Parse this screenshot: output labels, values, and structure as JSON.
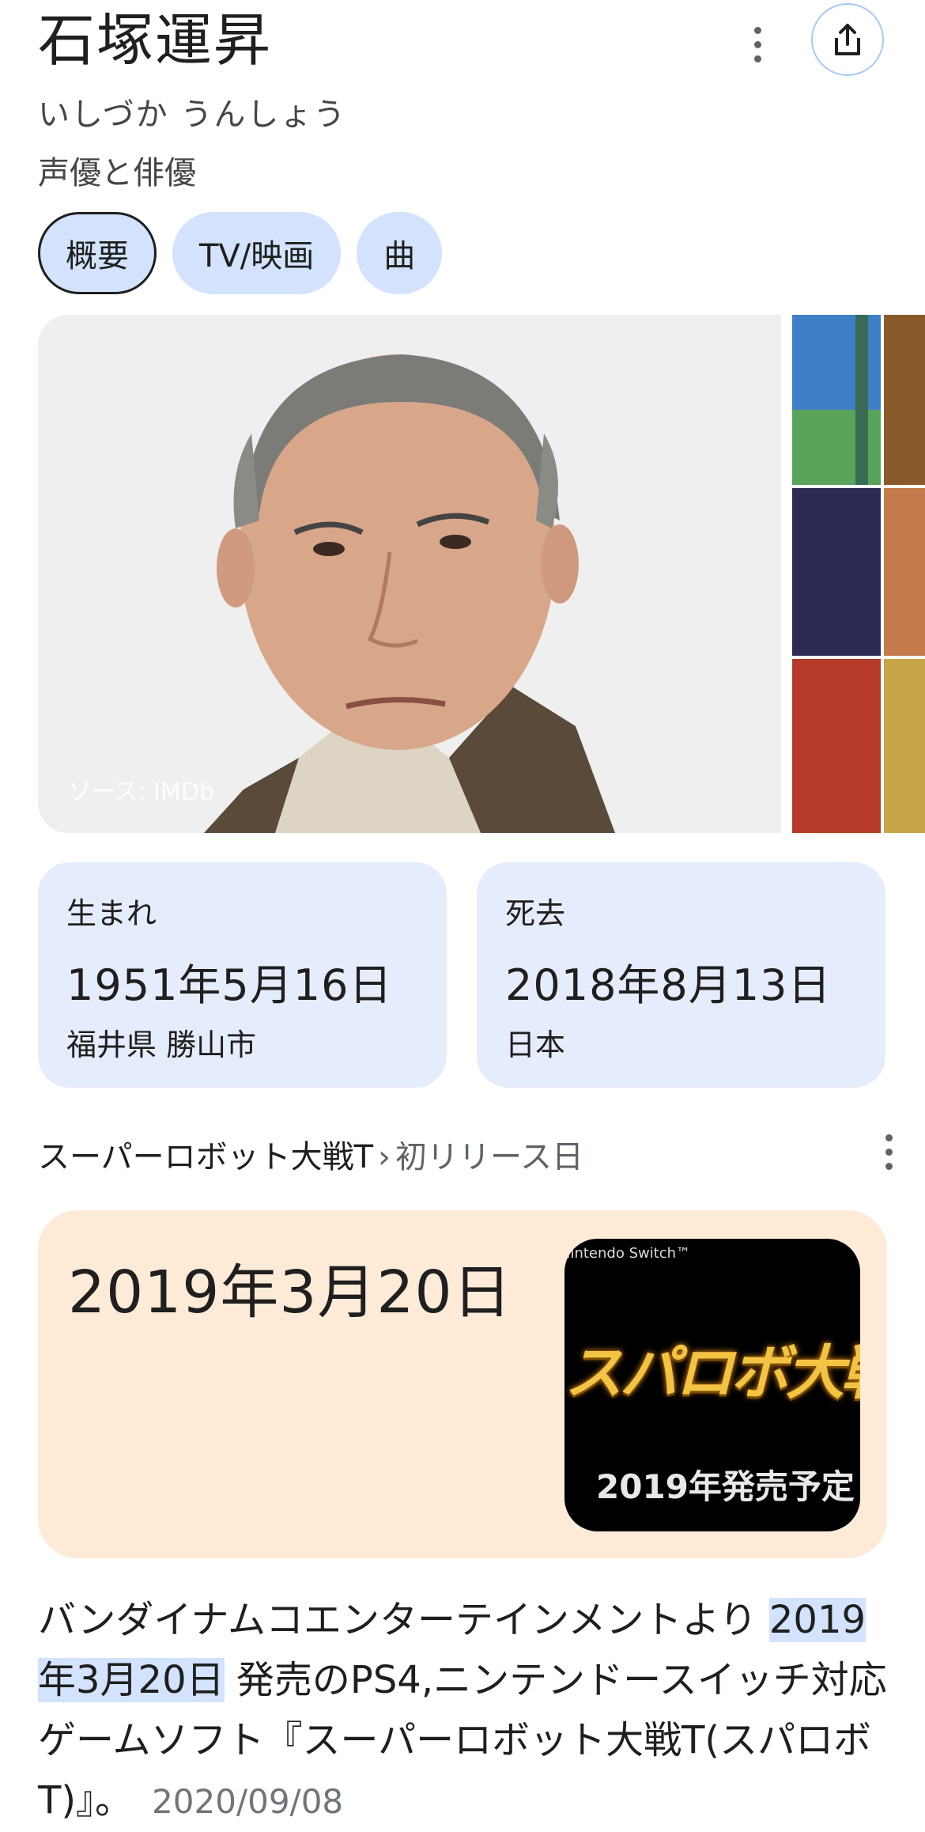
{
  "header": {
    "title": "石塚運昇",
    "reading": "いしづか うんしょう",
    "subtitle": "声優と俳優"
  },
  "tabs": [
    {
      "label": "概要",
      "active": true
    },
    {
      "label": "TV/映画",
      "active": false
    },
    {
      "label": "曲",
      "active": false
    }
  ],
  "gallery": {
    "source": "ソース: IMDb"
  },
  "facts": {
    "born": {
      "label": "生まれ",
      "date": "1951年5月16日",
      "place": "福井県 勝山市"
    },
    "died": {
      "label": "死去",
      "date": "2018年8月13日",
      "place": "日本"
    }
  },
  "result": {
    "breadcrumb_main": "スーパーロボット大戦T",
    "breadcrumb_sep": "›",
    "breadcrumb_sub": "初リリース日",
    "answer": "2019年3月20日",
    "thumb": {
      "brand": "Nintendo Switch™",
      "logo": "スパロボ大戦T",
      "release": "2019年発売予定"
    }
  },
  "snippet": {
    "before": "バンダイナムコエンターテインメントより ",
    "highlight": "2019年3月20日",
    "after": " 発売のPS4,ニンテンドースイッチ対応ゲームソフト『スーパーロボット大戦T(スパロボT)』。",
    "date": "2020/09/08"
  },
  "colors": {
    "chip_bg": "#d3e3fd",
    "card_blue": "#e5ecfb",
    "card_peach": "#fdebd8"
  }
}
